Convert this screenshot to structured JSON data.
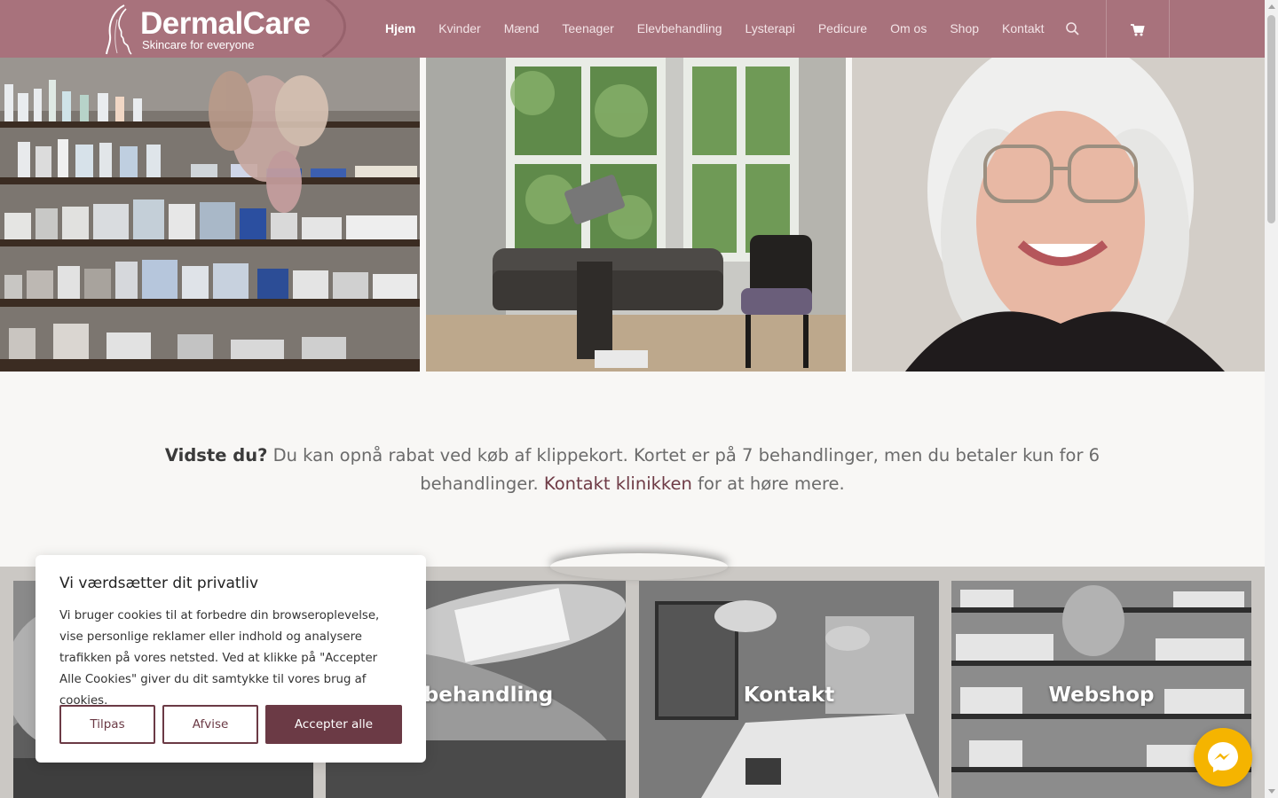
{
  "header": {
    "logo_name": "DermalCare",
    "logo_tagline": "Skincare for everyone",
    "nav": [
      "Hjem",
      "Kvinder",
      "Mænd",
      "Teenager",
      "Elevbehandling",
      "Lysterapi",
      "Pedicure",
      "Om os",
      "Shop",
      "Kontakt"
    ],
    "active": "Hjem",
    "icons": [
      "search-icon",
      "cart-icon"
    ],
    "bg_color": "#a8727c"
  },
  "hero": {
    "images": [
      "product-shelves",
      "treatment-room",
      "smiling-woman-portrait"
    ]
  },
  "info": {
    "lead": "Vidste du?",
    "text": " Du kan opnå rabat ved køb af klippekort. Kortet er på 7 behandlinger, men du betaler kun for 6 behandlinger. ",
    "link": "Kontakt klinikken",
    "tail": " for at høre mere."
  },
  "tiles": [
    {
      "title": ""
    },
    {
      "title": "ksbehandling"
    },
    {
      "title": "Kontakt"
    },
    {
      "title": "Webshop"
    }
  ],
  "cookie": {
    "title": "Vi værdsætter dit privatliv",
    "text": "Vi bruger cookies til at forbedre din browseroplevelse, vise personlige reklamer eller indhold og analysere trafikken på vores netsted. Ved at klikke på \"Accepter Alle Cookies\" giver du dit samtykke til vores brug af cookies.",
    "btn_customize": "Tilpas",
    "btn_reject": "Afvise",
    "btn_accept": "Accepter alle",
    "accent": "#6b3a45"
  },
  "messenger": {
    "icon": "messenger-icon",
    "color": "#f5b400"
  }
}
